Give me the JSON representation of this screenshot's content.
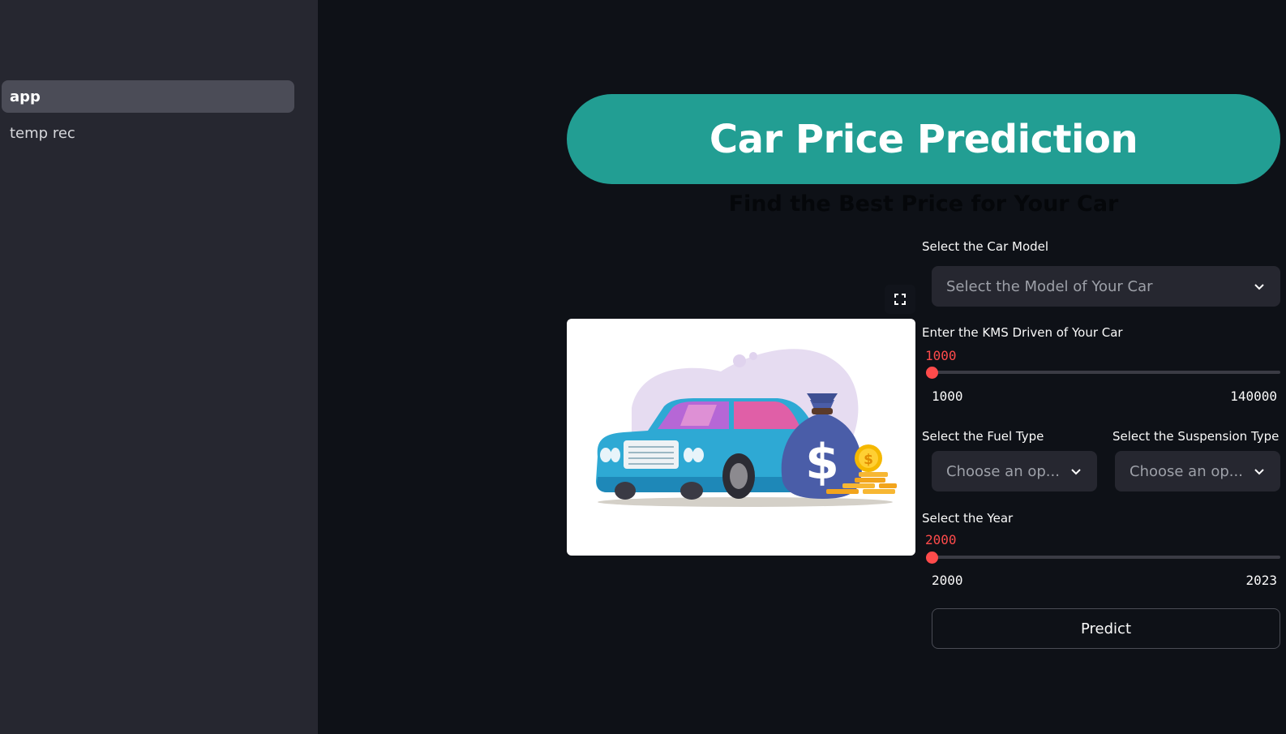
{
  "sidebar": {
    "items": [
      {
        "label": "app",
        "active": true
      },
      {
        "label": "temp rec",
        "active": false
      }
    ]
  },
  "header": {
    "title": "Car Price Prediction",
    "subtitle": "Find the Best Price for Your Car"
  },
  "image": {
    "expand_icon": "fullscreen-icon",
    "description_icon": "car-with-money-bag-illustration"
  },
  "form": {
    "car_model": {
      "label": "Select the Car Model",
      "placeholder": "Select the Model of Your Car"
    },
    "kms_driven": {
      "label": "Enter the KMS Driven of Your Car",
      "value": "1000",
      "min": "1000",
      "max": "140000",
      "fraction": 0
    },
    "fuel_type": {
      "label": "Select the Fuel Type",
      "placeholder": "Choose an op..."
    },
    "suspension_type": {
      "label": "Select the Suspension Type",
      "placeholder": "Choose an op..."
    },
    "year": {
      "label": "Select the Year",
      "value": "2000",
      "min": "2000",
      "max": "2023",
      "fraction": 0
    },
    "predict_label": "Predict"
  },
  "colors": {
    "banner": "#229e93",
    "accent": "#ff4b4b",
    "background": "#0e1117",
    "sidebar": "#262730"
  }
}
